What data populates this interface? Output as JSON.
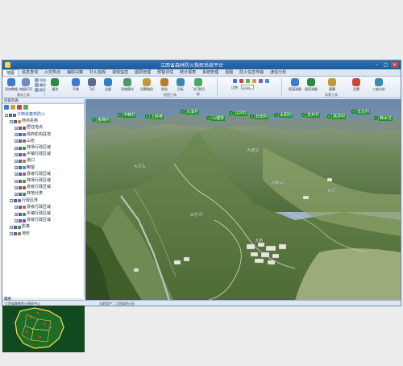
{
  "window": {
    "title": "江西省森林防火指挥系统平台"
  },
  "tabs": [
    "地图",
    "信息查询",
    "火灾热点",
    "辅助决策",
    "扑火指挥",
    "视频监控",
    "图层管理",
    "预警评估",
    "统计报表",
    "系统管理",
    "视图",
    "防火信息传输",
    "通信分析"
  ],
  "ribbon": {
    "big_buttons": [
      "添加数据",
      "地图打印",
      "漫游",
      "平移",
      "飞行",
      "全图",
      "导航模式",
      "设置路径",
      "指北",
      "目标",
      "飞行到目标"
    ],
    "small_buttons": [
      "添加",
      "删除",
      "保存"
    ],
    "scale_label": "比例",
    "scale_value": "0.001",
    "right_buttons": [
      "距离测量",
      "面积测量",
      "量算",
      "设置",
      "三维分析"
    ],
    "group_labels": [
      "基本工具",
      "地图工具",
      "场景工具"
    ]
  },
  "left_panel": {
    "header": "内容列表",
    "tree": [
      {
        "label": "江西省森林防火",
        "level": 0,
        "checked": true,
        "color": "#2a68c0"
      },
      {
        "label": "地点名称",
        "level": 1,
        "checked": true,
        "color": "#d28a1e"
      },
      {
        "label": "居住地点",
        "level": 2,
        "checked": true,
        "color": "#c03a2b"
      },
      {
        "label": "政府机构驻地",
        "level": 2,
        "checked": true,
        "color": "#4a7bd0"
      },
      {
        "label": "山名",
        "level": 2,
        "checked": true,
        "color": "#8a6a3a"
      },
      {
        "label": "林场行政区域",
        "level": 2,
        "checked": true,
        "color": "#2e9a3c"
      },
      {
        "label": "乡镇行政区域",
        "level": 2,
        "checked": true,
        "color": "#9a4ac0"
      },
      {
        "label": "道口",
        "level": 2,
        "checked": true,
        "color": "#c07a2b"
      },
      {
        "label": "瞭望",
        "level": 2,
        "checked": true,
        "color": "#3a9ab0"
      },
      {
        "label": "县级行政区域",
        "level": 2,
        "checked": true,
        "color": "#c04a6a"
      },
      {
        "label": "林场行政区域",
        "level": 2,
        "checked": true,
        "color": "#5a8a2a"
      },
      {
        "label": "省级行政区域",
        "level": 2,
        "checked": true,
        "color": "#b04a2a"
      },
      {
        "label": "林地分类",
        "level": 2,
        "checked": true,
        "color": "#2a8a5a"
      },
      {
        "label": "行政区界",
        "level": 1,
        "checked": true,
        "color": "#7a5ac0"
      },
      {
        "label": "县级行政区域",
        "level": 2,
        "checked": true,
        "color": "#c06a2b"
      },
      {
        "label": "乡镇行政区域",
        "level": 2,
        "checked": true,
        "color": "#3a7ac0"
      },
      {
        "label": "省级行政区域",
        "level": 2,
        "checked": true,
        "color": "#a03a8a"
      },
      {
        "label": "影像",
        "level": 1,
        "checked": true,
        "color": "#3a8a6a"
      },
      {
        "label": "地形",
        "level": 1,
        "checked": true,
        "color": "#8a7a3a"
      }
    ]
  },
  "minimap": {
    "header": "鹰眼"
  },
  "view3d": {
    "markers": [
      "金峰村",
      "中峰村",
      "上岭坡",
      "大溪村",
      "山塘排",
      "马坪村",
      "石田村",
      "太阳村",
      "龙井村",
      "高坪村",
      "长坑村",
      "黄水坑"
    ],
    "place_labels": [
      "大坑头",
      "大塘坝",
      "东坑",
      "白竹坪",
      "马鞍山",
      "大桥"
    ]
  },
  "status": {
    "left": "江西省森林防火指挥中心",
    "right": "当前用户：江西省防火办"
  }
}
